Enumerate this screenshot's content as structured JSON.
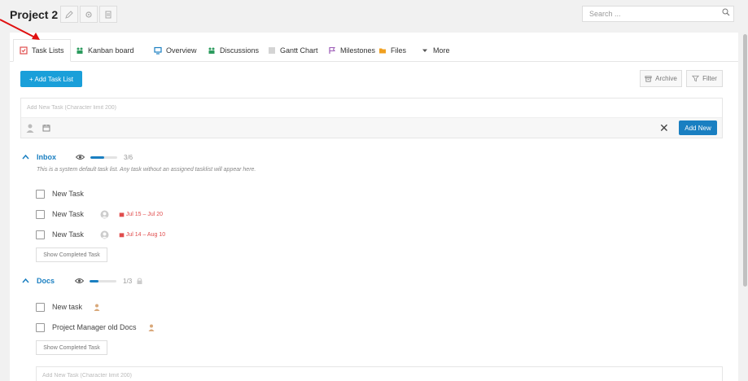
{
  "project": {
    "title": "Project 2"
  },
  "search": {
    "placeholder": "Search ..."
  },
  "tabs": [
    {
      "label": "Task Lists",
      "icon": "task-list-icon",
      "color": "#e04d4d"
    },
    {
      "label": "Kanban board",
      "icon": "kanban-icon",
      "color": "#2b9b5e"
    },
    {
      "label": "Overview",
      "icon": "monitor-icon",
      "color": "#1a7fc1"
    },
    {
      "label": "Discussions",
      "icon": "discussion-icon",
      "color": "#2b9b5e"
    },
    {
      "label": "Gantt Chart",
      "icon": "gantt-icon",
      "color": "#999999"
    },
    {
      "label": "Milestones",
      "icon": "flag-icon",
      "color": "#9b59b6"
    },
    {
      "label": "Files",
      "icon": "folder-icon",
      "color": "#f0a020"
    },
    {
      "label": "More",
      "icon": "caret-down-icon",
      "color": "#555555"
    }
  ],
  "toolbar": {
    "add_task_list": "+ Add Task List",
    "archive": "Archive",
    "filter": "Filter"
  },
  "new_task": {
    "placeholder": "Add New Task (Character limit 200)",
    "add_new": "Add New",
    "close": "✕"
  },
  "lists": [
    {
      "title": "Inbox",
      "progress": "3/6",
      "progress_fraction": 0.5,
      "description": "This is a system default task list. Any task without an assigned tasklist will appear here.",
      "tasks": [
        {
          "name": "New Task",
          "due": ""
        },
        {
          "name": "New Task",
          "due": "Jul 15 – Jul 20"
        },
        {
          "name": "New Task",
          "due": "Jul 14 – Aug 10"
        }
      ],
      "show_completed": "Show Completed Task"
    },
    {
      "title": "Docs",
      "progress": "1/3",
      "progress_fraction": 0.33,
      "tasks": [
        {
          "name": "New task"
        },
        {
          "name": "Project Manager old Docs"
        }
      ],
      "show_completed": "Show Completed Task"
    }
  ],
  "bottom_input": {
    "placeholder": "Add New Task (Character limit 200)"
  },
  "colors": {
    "accent": "#1a7fc1",
    "button_blue": "#1a9fd9",
    "due_red": "#e04d4d",
    "annotation_arrow": "#e01010"
  }
}
